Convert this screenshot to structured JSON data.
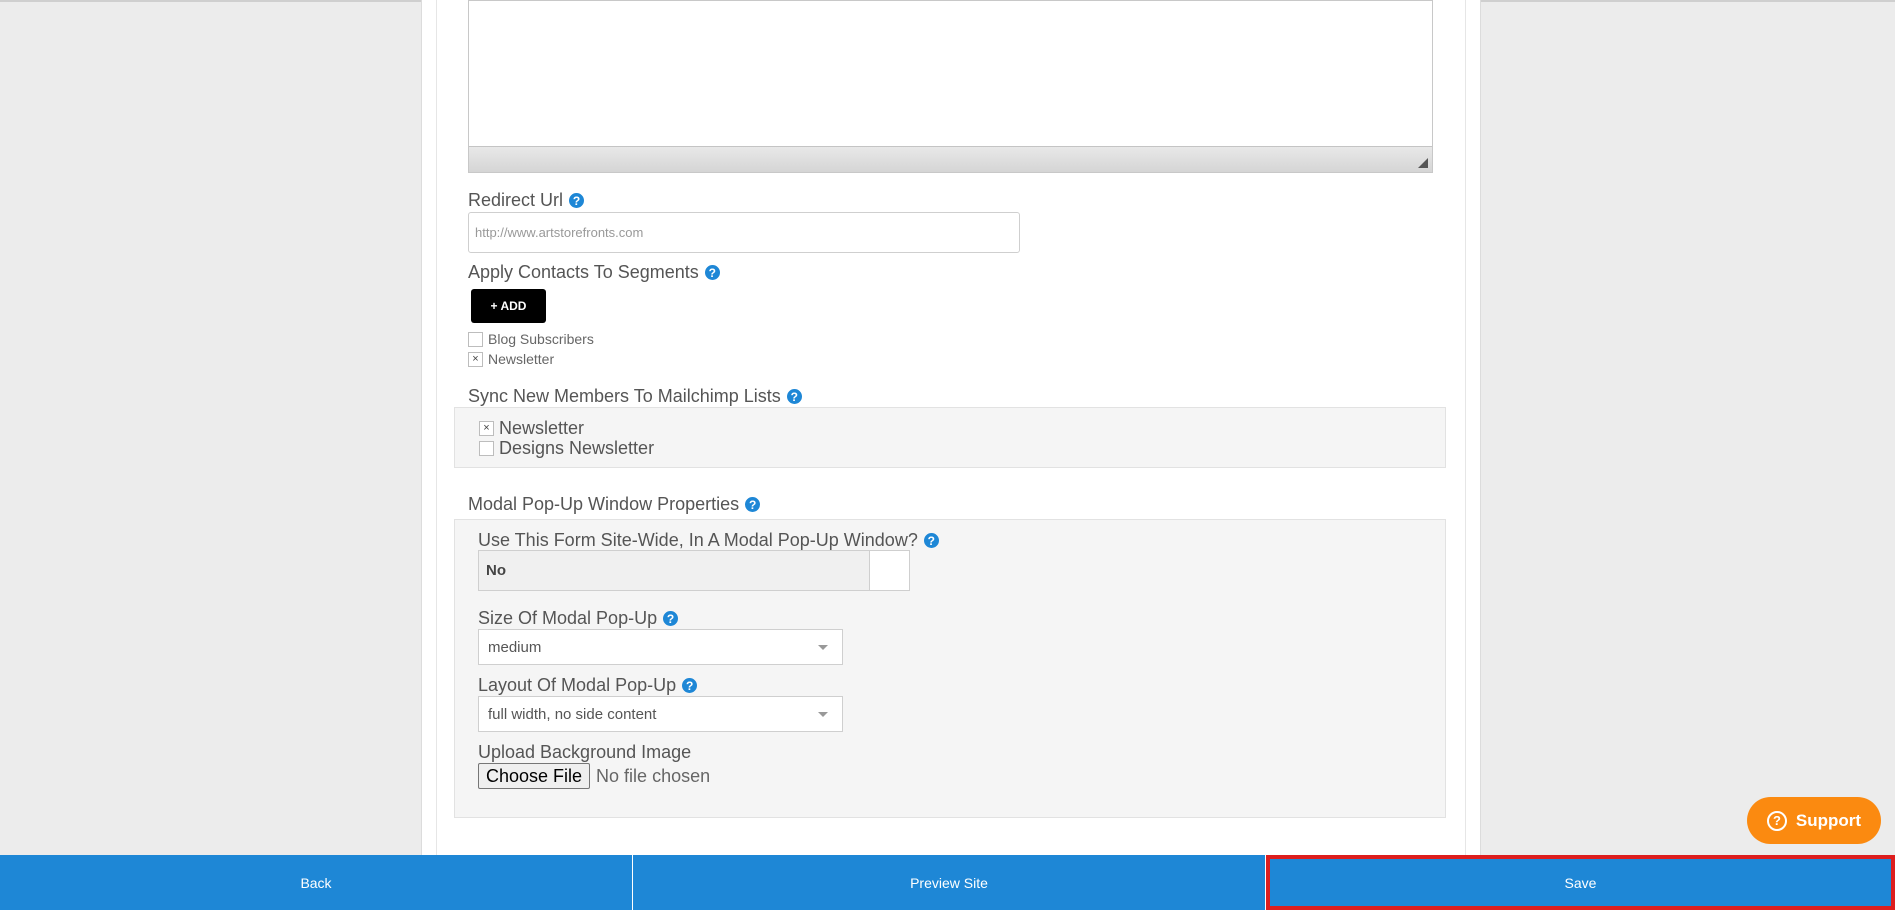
{
  "redirect": {
    "label": "Redirect Url",
    "placeholder": "http://www.artstorefronts.com"
  },
  "segments": {
    "label": "Apply Contacts To Segments",
    "add_label": "+ ADD",
    "items": [
      {
        "label": "Blog Subscribers",
        "checked": false,
        "mark": ""
      },
      {
        "label": "Newsletter",
        "checked": true,
        "mark": "×"
      }
    ]
  },
  "mailchimp": {
    "label": "Sync New Members To Mailchimp Lists",
    "items": [
      {
        "label": "Newsletter",
        "checked": true,
        "mark": "×"
      },
      {
        "label": "Designs Newsletter",
        "checked": false,
        "mark": ""
      }
    ]
  },
  "modal": {
    "section_label": "Modal Pop-Up Window Properties",
    "sitewide_label": "Use This Form Site-Wide, In A Modal Pop-Up Window?",
    "sitewide_value": "No",
    "size_label": "Size Of Modal Pop-Up",
    "size_value": "medium",
    "layout_label": "Layout Of Modal Pop-Up",
    "layout_value": "full width, no side content",
    "bg_label": "Upload Background Image",
    "choose_file_label": "Choose File",
    "file_status": "No file chosen"
  },
  "help_glyph": "?",
  "support": {
    "label": "Support",
    "glyph": "?"
  },
  "bottom_bar": {
    "back": "Back",
    "preview": "Preview Site",
    "save": "Save"
  },
  "colors": {
    "accent": "#1e87d6",
    "support": "#fb8a10",
    "highlight": "#dd1e1e"
  }
}
